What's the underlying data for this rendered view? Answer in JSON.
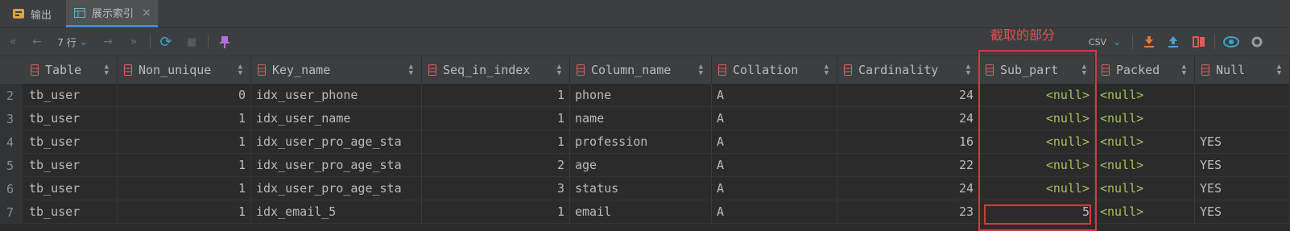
{
  "tabs": [
    {
      "label": "输出",
      "icon": "output-icon",
      "active": false
    },
    {
      "label": "展示索引",
      "icon": "table-icon",
      "active": true,
      "close": "×"
    }
  ],
  "toolbar": {
    "first": "«",
    "prev": "←",
    "rows_label": "7 行",
    "rows_chevron": "⌄",
    "next": "→",
    "last": "»",
    "refresh": "⟳",
    "stop": "■",
    "pin": "📌",
    "export_format": "CSV",
    "export_chevron": "⌄"
  },
  "annotation": "截取的部分",
  "columns": [
    "Table",
    "Non_unique",
    "Key_name",
    "Seq_in_index",
    "Column_name",
    "Collation",
    "Cardinality",
    "Sub_part",
    "Packed",
    "Null"
  ],
  "rows": [
    {
      "n": "2",
      "cells": [
        "tb_user",
        "0",
        "idx_user_phone",
        "1",
        "phone",
        "A",
        "24",
        "<null>",
        "<null>",
        ""
      ]
    },
    {
      "n": "3",
      "cells": [
        "tb_user",
        "1",
        "idx_user_name",
        "1",
        "name",
        "A",
        "24",
        "<null>",
        "<null>",
        ""
      ]
    },
    {
      "n": "4",
      "cells": [
        "tb_user",
        "1",
        "idx_user_pro_age_sta",
        "1",
        "profession",
        "A",
        "16",
        "<null>",
        "<null>",
        "YES"
      ]
    },
    {
      "n": "5",
      "cells": [
        "tb_user",
        "1",
        "idx_user_pro_age_sta",
        "2",
        "age",
        "A",
        "22",
        "<null>",
        "<null>",
        "YES"
      ]
    },
    {
      "n": "6",
      "cells": [
        "tb_user",
        "1",
        "idx_user_pro_age_sta",
        "3",
        "status",
        "A",
        "24",
        "<null>",
        "<null>",
        "YES"
      ]
    },
    {
      "n": "7",
      "cells": [
        "tb_user",
        "1",
        "idx_email_5",
        "1",
        "email",
        "A",
        "23",
        "5",
        "<null>",
        "YES"
      ]
    }
  ],
  "colors": {
    "null_value": "#a5c25c",
    "annotation": "#e84a4a",
    "accent": "#4a88c7"
  }
}
